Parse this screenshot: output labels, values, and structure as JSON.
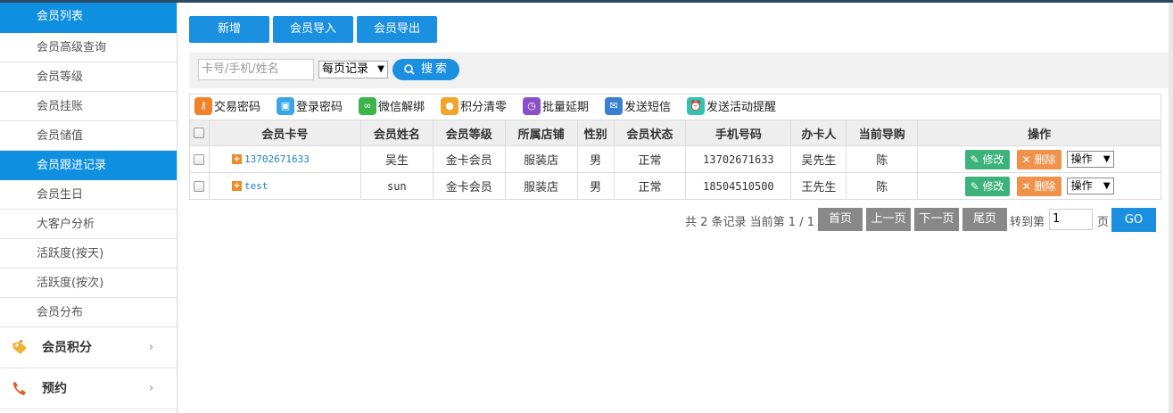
{
  "sidebar": {
    "items": [
      {
        "label": "会员列表",
        "active": true
      },
      {
        "label": "会员高级查询",
        "active": false
      },
      {
        "label": "会员等级",
        "active": false
      },
      {
        "label": "会员挂账",
        "active": false
      },
      {
        "label": "会员储值",
        "active": false
      },
      {
        "label": "会员跟进记录",
        "active": true
      },
      {
        "label": "会员生日",
        "active": false
      },
      {
        "label": "大客户分析",
        "active": false
      },
      {
        "label": "活跃度(按天)",
        "active": false
      },
      {
        "label": "活跃度(按次)",
        "active": false
      },
      {
        "label": "会员分布",
        "active": false
      }
    ],
    "groups": [
      {
        "label": "会员积分",
        "icon": "tag-icon",
        "chevron": "›"
      },
      {
        "label": "预约",
        "icon": "phone-icon",
        "chevron": "›"
      }
    ]
  },
  "toolbar_buttons": {
    "add": "新增",
    "import": "会员导入",
    "export": "会员导出"
  },
  "search": {
    "placeholder": "卡号/手机/姓名",
    "page_size_label": "每页记录",
    "button_label": "搜索"
  },
  "actions": [
    {
      "label": "交易密码",
      "icon": "key-icon",
      "color": "#f0822b"
    },
    {
      "label": "登录密码",
      "icon": "lock-icon",
      "color": "#3aa6e8"
    },
    {
      "label": "微信解绑",
      "icon": "link-icon",
      "color": "#3db34a"
    },
    {
      "label": "积分清零",
      "icon": "medal-icon",
      "color": "#f2a42a"
    },
    {
      "label": "批量延期",
      "icon": "clock-icon",
      "color": "#8a4fc8"
    },
    {
      "label": "发送短信",
      "icon": "mail-icon",
      "color": "#3a7fd0"
    },
    {
      "label": "发送活动提醒",
      "icon": "alarm-icon",
      "color": "#2fc4b0"
    }
  ],
  "table": {
    "headers": [
      "会员卡号",
      "会员姓名",
      "会员等级",
      "所属店铺",
      "性别",
      "会员状态",
      "手机号码",
      "办卡人",
      "当前导购",
      "操作"
    ],
    "rows": [
      {
        "card": "13702671633",
        "name": "吴生",
        "level": "金卡会员",
        "store": "服装店",
        "gender": "男",
        "status": "正常",
        "phone": "13702671633",
        "issuer": "吴先生",
        "guide": "陈"
      },
      {
        "card": "test",
        "name": "sun",
        "level": "金卡会员",
        "store": "服装店",
        "gender": "男",
        "status": "正常",
        "phone": "18504510500",
        "issuer": "王先生",
        "guide": "陈"
      }
    ],
    "edit_label": "修改",
    "delete_label": "删除",
    "op_select": "操作"
  },
  "pager": {
    "info": "共 2 条记录 当前第 1 / 1",
    "first": "首页",
    "prev": "上一页",
    "next": "下一页",
    "last": "尾页",
    "goto_label": "转到第",
    "page_value": "1",
    "page_suffix": "页",
    "go": "GO"
  },
  "colors": {
    "primary": "#1b8fe0",
    "edit": "#3db37b",
    "delete": "#f0924b",
    "pager_button": "#888888"
  }
}
